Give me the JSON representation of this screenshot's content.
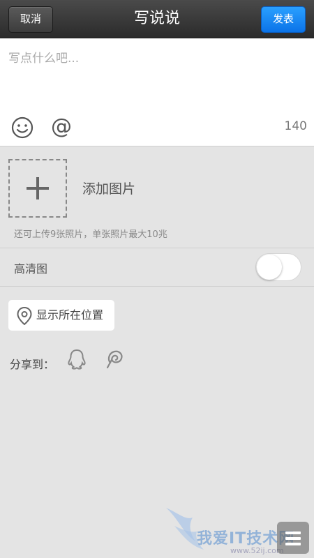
{
  "header": {
    "cancel_label": "取消",
    "title": "写说说",
    "publish_label": "发表"
  },
  "compose": {
    "placeholder": "写点什么吧...",
    "emoji_icon": "smiley-face-icon",
    "mention_symbol": "@",
    "char_count": "140"
  },
  "photos": {
    "add_icon": "plus-icon",
    "add_label": "添加图片",
    "hint": "还可上传9张照片，单张照片最大10兆"
  },
  "hd": {
    "label": "高清图",
    "enabled": false
  },
  "location": {
    "icon": "location-pin-icon",
    "label": "显示所在位置"
  },
  "share": {
    "label": "分享到：",
    "targets": [
      {
        "icon": "qq-penguin-icon"
      },
      {
        "icon": "weibo-icon"
      }
    ]
  },
  "watermark": {
    "text": "我爱IT技术网",
    "url": "www.52ij.com"
  },
  "colors": {
    "publish_blue": "#0b73e8",
    "topbar_dark": "#2b2b2b",
    "background": "#e4e4e4"
  }
}
